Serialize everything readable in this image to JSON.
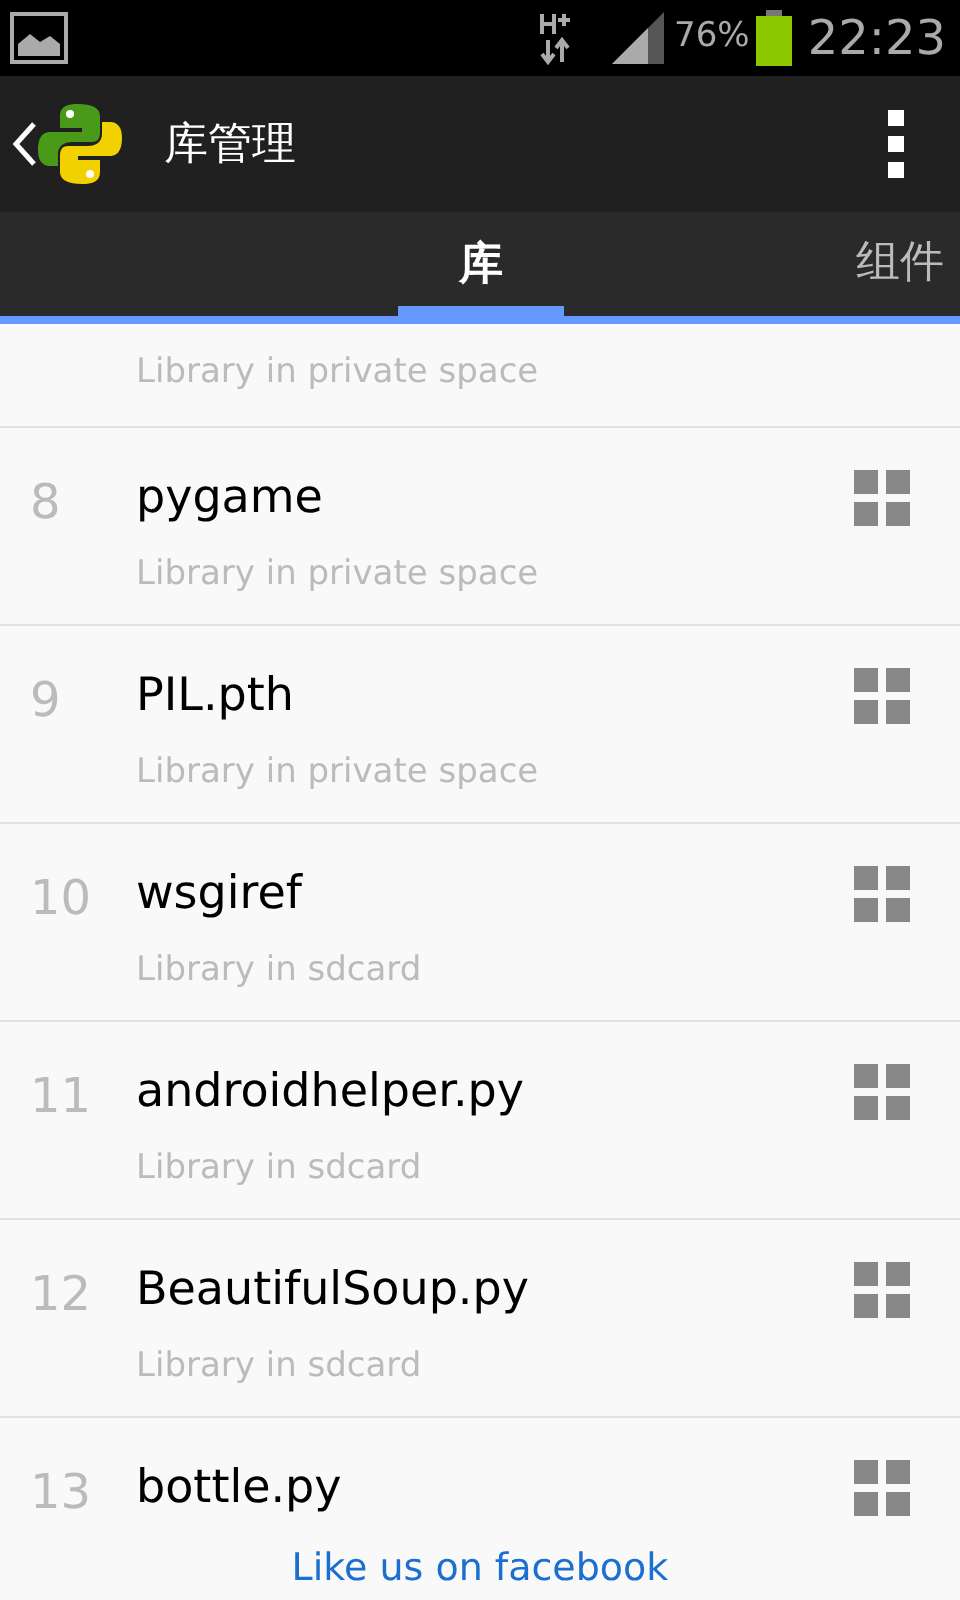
{
  "status_bar": {
    "battery": "76%",
    "time": "22:23"
  },
  "header": {
    "title": "库管理"
  },
  "tabs": [
    {
      "label": "库",
      "selected": true
    },
    {
      "label": "组件",
      "selected": false
    }
  ],
  "rows": [
    {
      "subtitle": "Library in private space"
    },
    {
      "number": "8",
      "title": "pygame",
      "subtitle": "Library in private space"
    },
    {
      "number": "9",
      "title": "PIL.pth",
      "subtitle": "Library in private space"
    },
    {
      "number": "10",
      "title": "wsgiref",
      "subtitle": "Library in sdcard"
    },
    {
      "number": "11",
      "title": "androidhelper.py",
      "subtitle": "Library in sdcard"
    },
    {
      "number": "12",
      "title": "BeautifulSoup.py",
      "subtitle": "Library in sdcard"
    },
    {
      "number": "13",
      "title": "bottle.py"
    }
  ],
  "footer": {
    "link": "Like us on facebook"
  }
}
